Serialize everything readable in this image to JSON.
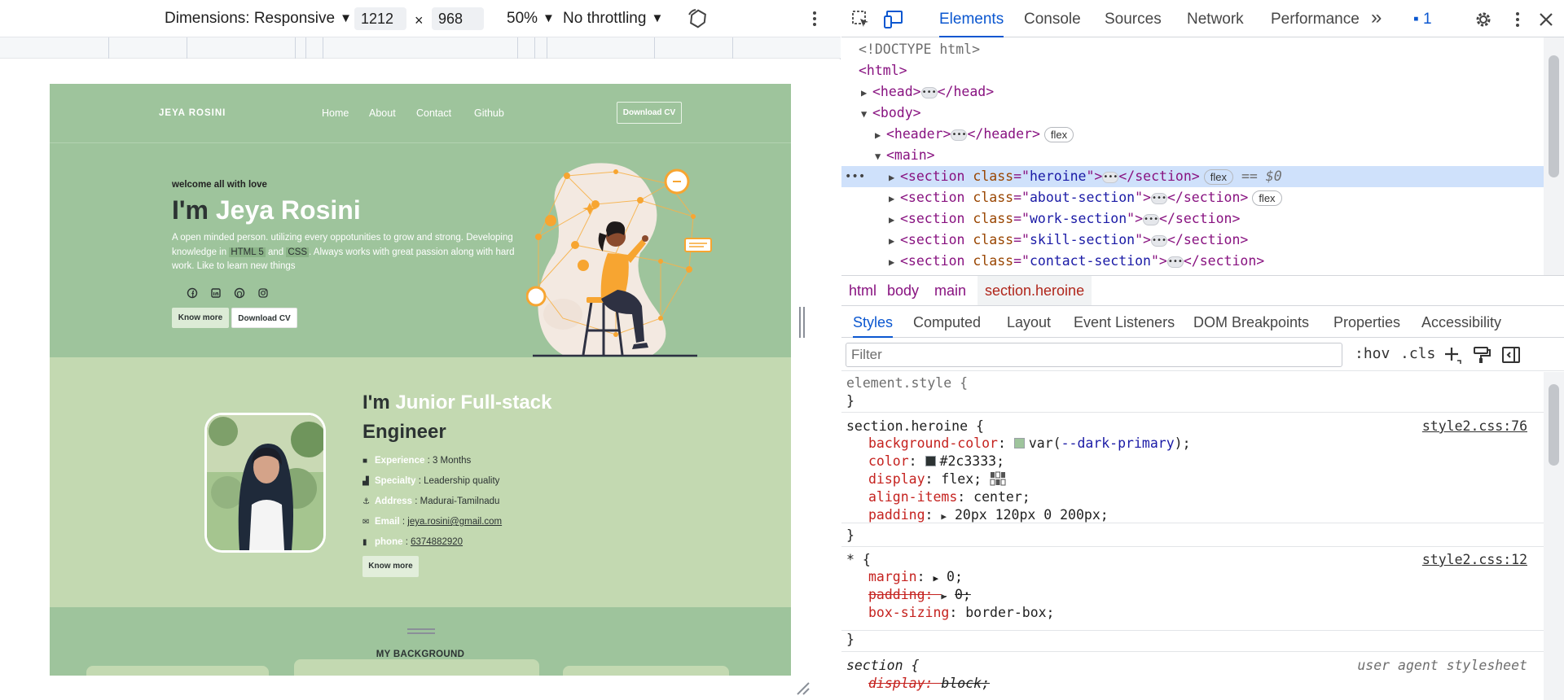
{
  "device_toolbar": {
    "dimensions_label": "Dimensions: Responsive",
    "width": "1212",
    "times": "×",
    "height": "968",
    "zoom": "50%",
    "throttling": "No throttling"
  },
  "site": {
    "logo": "JEYA ROSINI",
    "nav": [
      "Home",
      "About",
      "Contact",
      "Github"
    ],
    "header_cv_button": "Download CV",
    "hero": {
      "welcome": "welcome all with love",
      "title_prefix": "I'm ",
      "title_name": "Jeya Rosini",
      "desc_part1": "A open minded person. utilizing every oppotunities to grow and strong. Developing knowledge in ",
      "desc_code1": "HTML 5",
      "desc_part2": " and ",
      "desc_code2": "CSS",
      "desc_part3": ". Always works with great passion along with hard work. Like to learn new things",
      "know_more": "Know more",
      "download_cv": "Download CV"
    },
    "about": {
      "title_prefix": "I'm ",
      "title_highlight": "Junior Full-stack",
      "title_line2": "Engineer",
      "rows": [
        {
          "label": "Experience",
          "value": " : 3 Months"
        },
        {
          "label": "Specialty",
          "value": " : Leadership quality"
        },
        {
          "label": "Address",
          "value": " : Madurai-Tamilnadu"
        },
        {
          "label": "Email",
          "value": " : ",
          "link": "jeya.rosini@gmail.com"
        },
        {
          "label": "phone",
          "value": " : ",
          "link": "6374882920"
        }
      ],
      "know_more": "Know more"
    },
    "background_title": "MY BACKGROUND",
    "colors": {
      "dark_primary": "#9ec49c",
      "light_primary": "#c3d9b1",
      "text": "#2c3333",
      "illustration_orange": "#f7a531"
    }
  },
  "devtools": {
    "tabs": [
      "Elements",
      "Console",
      "Sources",
      "Network",
      "Performance"
    ],
    "more_tabs": "»",
    "issues_count": "1",
    "dom": {
      "doctype": "<!DOCTYPE html>",
      "html": "<html>",
      "head_open": "<head>",
      "head_close": "</head>",
      "body": "<body>",
      "header_open": "<header>",
      "header_close": "</header>",
      "main": "<main>",
      "sections": [
        "heroine",
        "about-section",
        "work-section",
        "skill-section",
        "contact-section"
      ],
      "section_tag": "<section ",
      "section_close": "</section>",
      "class_attr": "class",
      "flex_badge": "flex",
      "selected_marker": "== $0",
      "dots": "•••"
    },
    "breadcrumb": [
      "html",
      "body",
      "main",
      "section.heroine"
    ],
    "sub_tabs": [
      "Styles",
      "Computed",
      "Layout",
      "Event Listeners",
      "DOM Breakpoints",
      "Properties",
      "Accessibility"
    ],
    "filter_placeholder": "Filter",
    "filter_buttons": [
      ":hov",
      ".cls"
    ],
    "styles": {
      "element_style": "element.style {",
      "close_brace": "}",
      "rule1_selector": "section.heroine {",
      "rule1_source": "style2.css:76",
      "rule1_bg_prop": "background-color",
      "rule1_bg_val_pre": "var(",
      "rule1_bg_var": "--dark-primary",
      "rule1_bg_val_post": ");",
      "rule1_color_prop": "color",
      "rule1_color_val": "#2c3333;",
      "rule1_display_prop": "display",
      "rule1_display_val": "flex;",
      "rule1_align_prop": "align-items",
      "rule1_align_val": "center;",
      "rule1_padding_prop": "padding",
      "rule1_padding_val": "20px 120px 0 200px;",
      "rule2_selector": "* {",
      "rule2_source": "style2.css:12",
      "rule2_margin_prop": "margin",
      "rule2_margin_val": "0;",
      "rule2_padding_prop": "padding",
      "rule2_padding_val": "0;",
      "rule2_box_prop": "box-sizing",
      "rule2_box_val": "border-box;",
      "rule3_selector": "section {",
      "rule3_source": "user agent stylesheet",
      "rule3_display_prop": "display",
      "rule3_display_val": "block;"
    },
    "colors": {
      "accent": "#0b57d0",
      "tag": "#881280",
      "attr_name": "#994500",
      "attr_value": "#1a1aa6",
      "swatch_green": "#9ec49c",
      "swatch_dark": "#2c3333"
    }
  }
}
